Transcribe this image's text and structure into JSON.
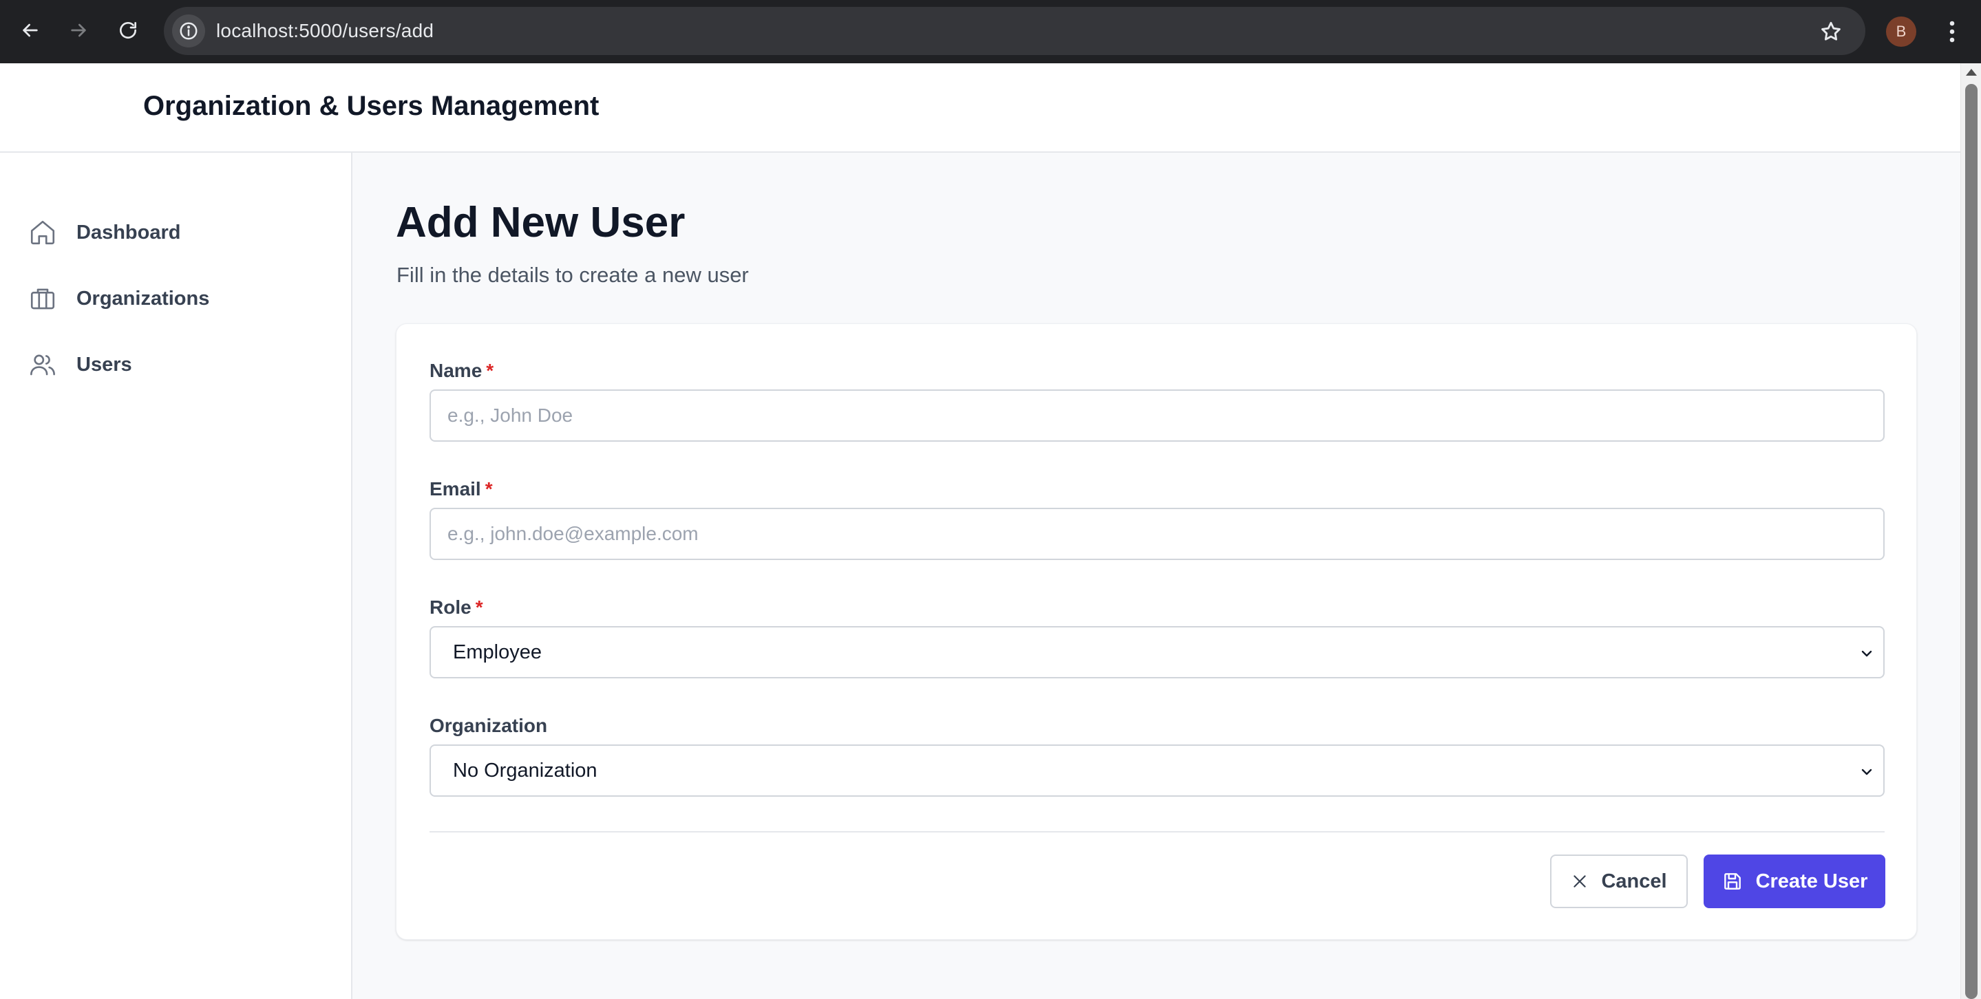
{
  "browser": {
    "url": "localhost:5000/users/add",
    "profile_initial": "B"
  },
  "app": {
    "title": "Organization & Users Management"
  },
  "sidebar": {
    "items": [
      {
        "label": "Dashboard",
        "icon": "home-icon"
      },
      {
        "label": "Organizations",
        "icon": "briefcase-icon"
      },
      {
        "label": "Users",
        "icon": "users-icon"
      }
    ]
  },
  "page": {
    "title": "Add New User",
    "subtitle": "Fill in the details to create a new user"
  },
  "form": {
    "name": {
      "label": "Name",
      "required_mark": "*",
      "placeholder": "e.g., John Doe",
      "value": ""
    },
    "email": {
      "label": "Email",
      "required_mark": "*",
      "placeholder": "e.g., john.doe@example.com",
      "value": ""
    },
    "role": {
      "label": "Role",
      "required_mark": "*",
      "selected": "Employee"
    },
    "organization": {
      "label": "Organization",
      "selected": "No Organization"
    },
    "cancel_label": "Cancel",
    "submit_label": "Create User"
  },
  "colors": {
    "accent": "#4f46e5",
    "required": "#dc2626",
    "browser_chrome": "#202124"
  }
}
